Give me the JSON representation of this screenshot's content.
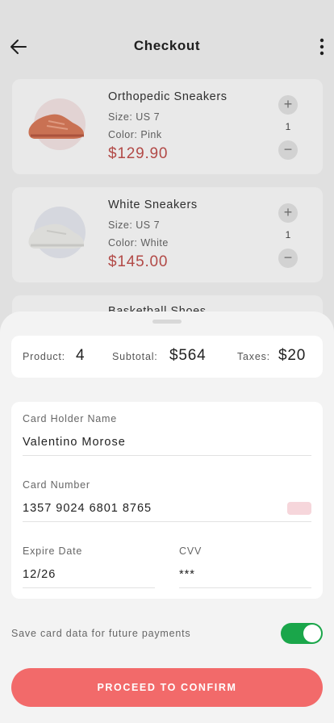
{
  "header": {
    "title": "Checkout"
  },
  "products": [
    {
      "name": "Orthopedic Sneakers",
      "size": "Size: US 7",
      "color": "Color: Pink",
      "price": "$129.90",
      "quantity": "1",
      "thumb_color": "#d97a5a"
    },
    {
      "name": "White Sneakers",
      "size": "Size: US 7",
      "color": "Color: White",
      "price": "$145.00",
      "quantity": "1",
      "thumb_color": "#e9e9e6"
    },
    {
      "name": "Basketball Shoes"
    }
  ],
  "summary": {
    "product_label": "Product:",
    "product_value": "4",
    "subtotal_label": "Subtotal:",
    "subtotal_value": "$564",
    "taxes_label": "Taxes:",
    "taxes_value": "$20"
  },
  "card": {
    "holder_label": "Card Holder Name",
    "holder_value": "Valentino Morose",
    "number_label": "Card Number",
    "number_value": "1357 9024 6801 8765",
    "expire_label": "Expire Date",
    "expire_value": "12/26",
    "cvv_label": "CVV",
    "cvv_value": "***"
  },
  "save_card": {
    "label": "Save card data for future payments",
    "enabled": true
  },
  "proceed_label": "PROCEED TO CONFIRM",
  "colors": {
    "accent": "#f26a6a",
    "price": "#c0504d",
    "toggle_on": "#1aa64a"
  }
}
